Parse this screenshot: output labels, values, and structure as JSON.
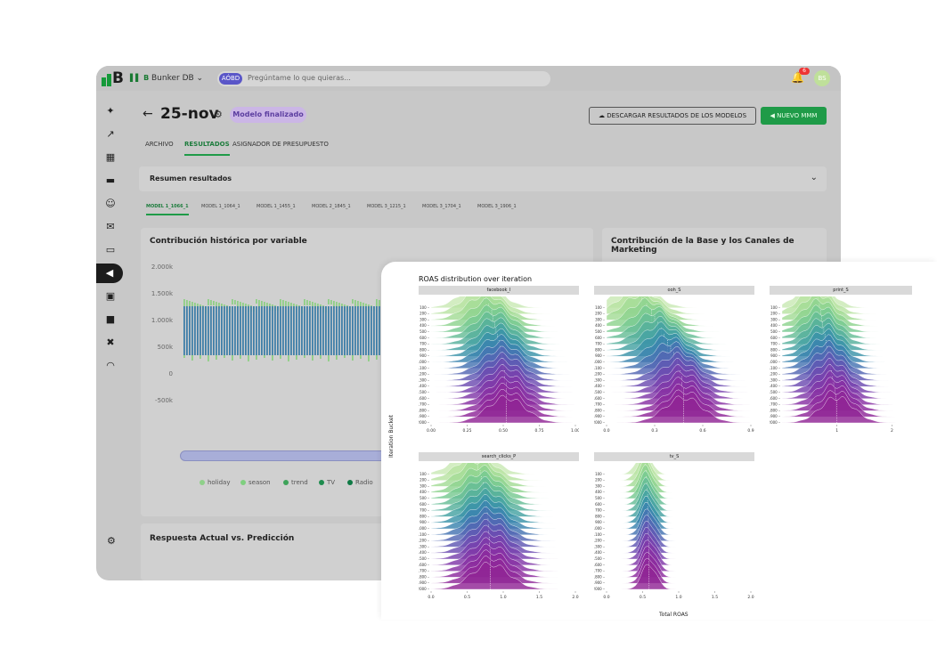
{
  "app": {
    "logo_letter": "B",
    "db_mini": "▌▌ B",
    "database_name": "Bunker DB  ⌄",
    "search": {
      "pill": "AÓBD",
      "placeholder": "Pregúntame lo que quieras..."
    },
    "notification_count": "6",
    "avatar_initials": "BS"
  },
  "page": {
    "title": "25-nov",
    "status_badge": "Modelo finalizado",
    "download_button": "DESCARGAR RESULTADOS DE LOS MODELOS",
    "new_button": "NUEVO MMM",
    "tabs": [
      "ARCHIVO",
      "RESULTADOS",
      "ASIGNADOR DE PRESUPUESTO"
    ],
    "active_tab": "RESULTADOS"
  },
  "summary": {
    "label": "Resumen resultados"
  },
  "model_tabs": [
    "MODEL 1_1066_1",
    "MODEL 1_1064_1",
    "MODEL 1_1455_1",
    "MODEL 2_1845_1",
    "MODEL 3_1215_1",
    "MODEL 3_1704_1",
    "MODEL 3_1906_1"
  ],
  "cards": {
    "historical_title": "Contribución histórica por variable",
    "base_title": "Contribución de la Base y los Canales de Marketing",
    "prediction_title": "Respuesta Actual vs. Predicción",
    "y_ticks": [
      "2.000k",
      "1.500k",
      "1.000k",
      "500k",
      "0",
      "-500k"
    ],
    "legend": [
      {
        "label": "holiday",
        "color": "#8fd08a"
      },
      {
        "label": "season",
        "color": "#7fcf7f"
      },
      {
        "label": "trend",
        "color": "#3ea35a"
      },
      {
        "label": "TV",
        "color": "#1e8c4e"
      },
      {
        "label": "Radio",
        "color": "#0f7a45"
      }
    ]
  },
  "chart_data": {
    "type": "ridgeline",
    "title": "ROAS distribution over iteration",
    "ylabel": "Iteration Bucket",
    "xlabel": "Total ROAS",
    "y_categories": [
      "100",
      "200",
      "300",
      "400",
      "500",
      "600",
      "700",
      "800",
      "900",
      "1000",
      "1100",
      "1200",
      "1300",
      "1400",
      "1500",
      "1600",
      "1700",
      "1800",
      "1900",
      "2000"
    ],
    "facets": [
      {
        "name": "facebook_I",
        "x_ticks": [
          "0.00",
          "0.25",
          "0.50",
          "0.75",
          "1.00"
        ],
        "x_range": [
          0,
          1.0
        ],
        "centers": [
          0.35,
          0.36,
          0.38,
          0.4,
          0.42,
          0.43,
          0.44,
          0.45,
          0.46,
          0.47,
          0.48,
          0.49,
          0.5,
          0.5,
          0.51,
          0.51,
          0.52,
          0.52,
          0.52,
          0.52
        ]
      },
      {
        "name": "ooh_S",
        "x_ticks": [
          "0.0",
          "0.3",
          "0.6",
          "0.9"
        ],
        "x_range": [
          0,
          0.9
        ],
        "centers": [
          0.18,
          0.2,
          0.22,
          0.25,
          0.28,
          0.3,
          0.32,
          0.34,
          0.36,
          0.38,
          0.4,
          0.42,
          0.44,
          0.45,
          0.46,
          0.47,
          0.47,
          0.48,
          0.48,
          0.48
        ]
      },
      {
        "name": "print_S",
        "x_ticks": [
          "1",
          "2"
        ],
        "x_range": [
          0,
          2.3
        ],
        "centers": [
          0.6,
          0.62,
          0.65,
          0.68,
          0.7,
          0.72,
          0.74,
          0.76,
          0.78,
          0.8,
          0.82,
          0.84,
          0.86,
          0.88,
          0.9,
          0.92,
          0.94,
          0.96,
          0.98,
          1.0
        ]
      },
      {
        "name": "search_clicks_P",
        "x_ticks": [
          "0.0",
          "0.5",
          "1.0",
          "1.5",
          "2.0"
        ],
        "x_range": [
          0,
          2.0
        ],
        "centers": [
          0.6,
          0.62,
          0.65,
          0.68,
          0.7,
          0.72,
          0.74,
          0.75,
          0.76,
          0.77,
          0.78,
          0.79,
          0.8,
          0.8,
          0.81,
          0.81,
          0.82,
          0.82,
          0.82,
          0.82
        ]
      },
      {
        "name": "tv_S",
        "x_ticks": [
          "0.0",
          "0.5",
          "1.0",
          "1.5",
          "2.0"
        ],
        "x_range": [
          0,
          2.0
        ],
        "centers": [
          0.52,
          0.53,
          0.54,
          0.55,
          0.55,
          0.56,
          0.56,
          0.57,
          0.57,
          0.57,
          0.58,
          0.58,
          0.58,
          0.58,
          0.58,
          0.59,
          0.59,
          0.59,
          0.59,
          0.59
        ]
      }
    ]
  }
}
